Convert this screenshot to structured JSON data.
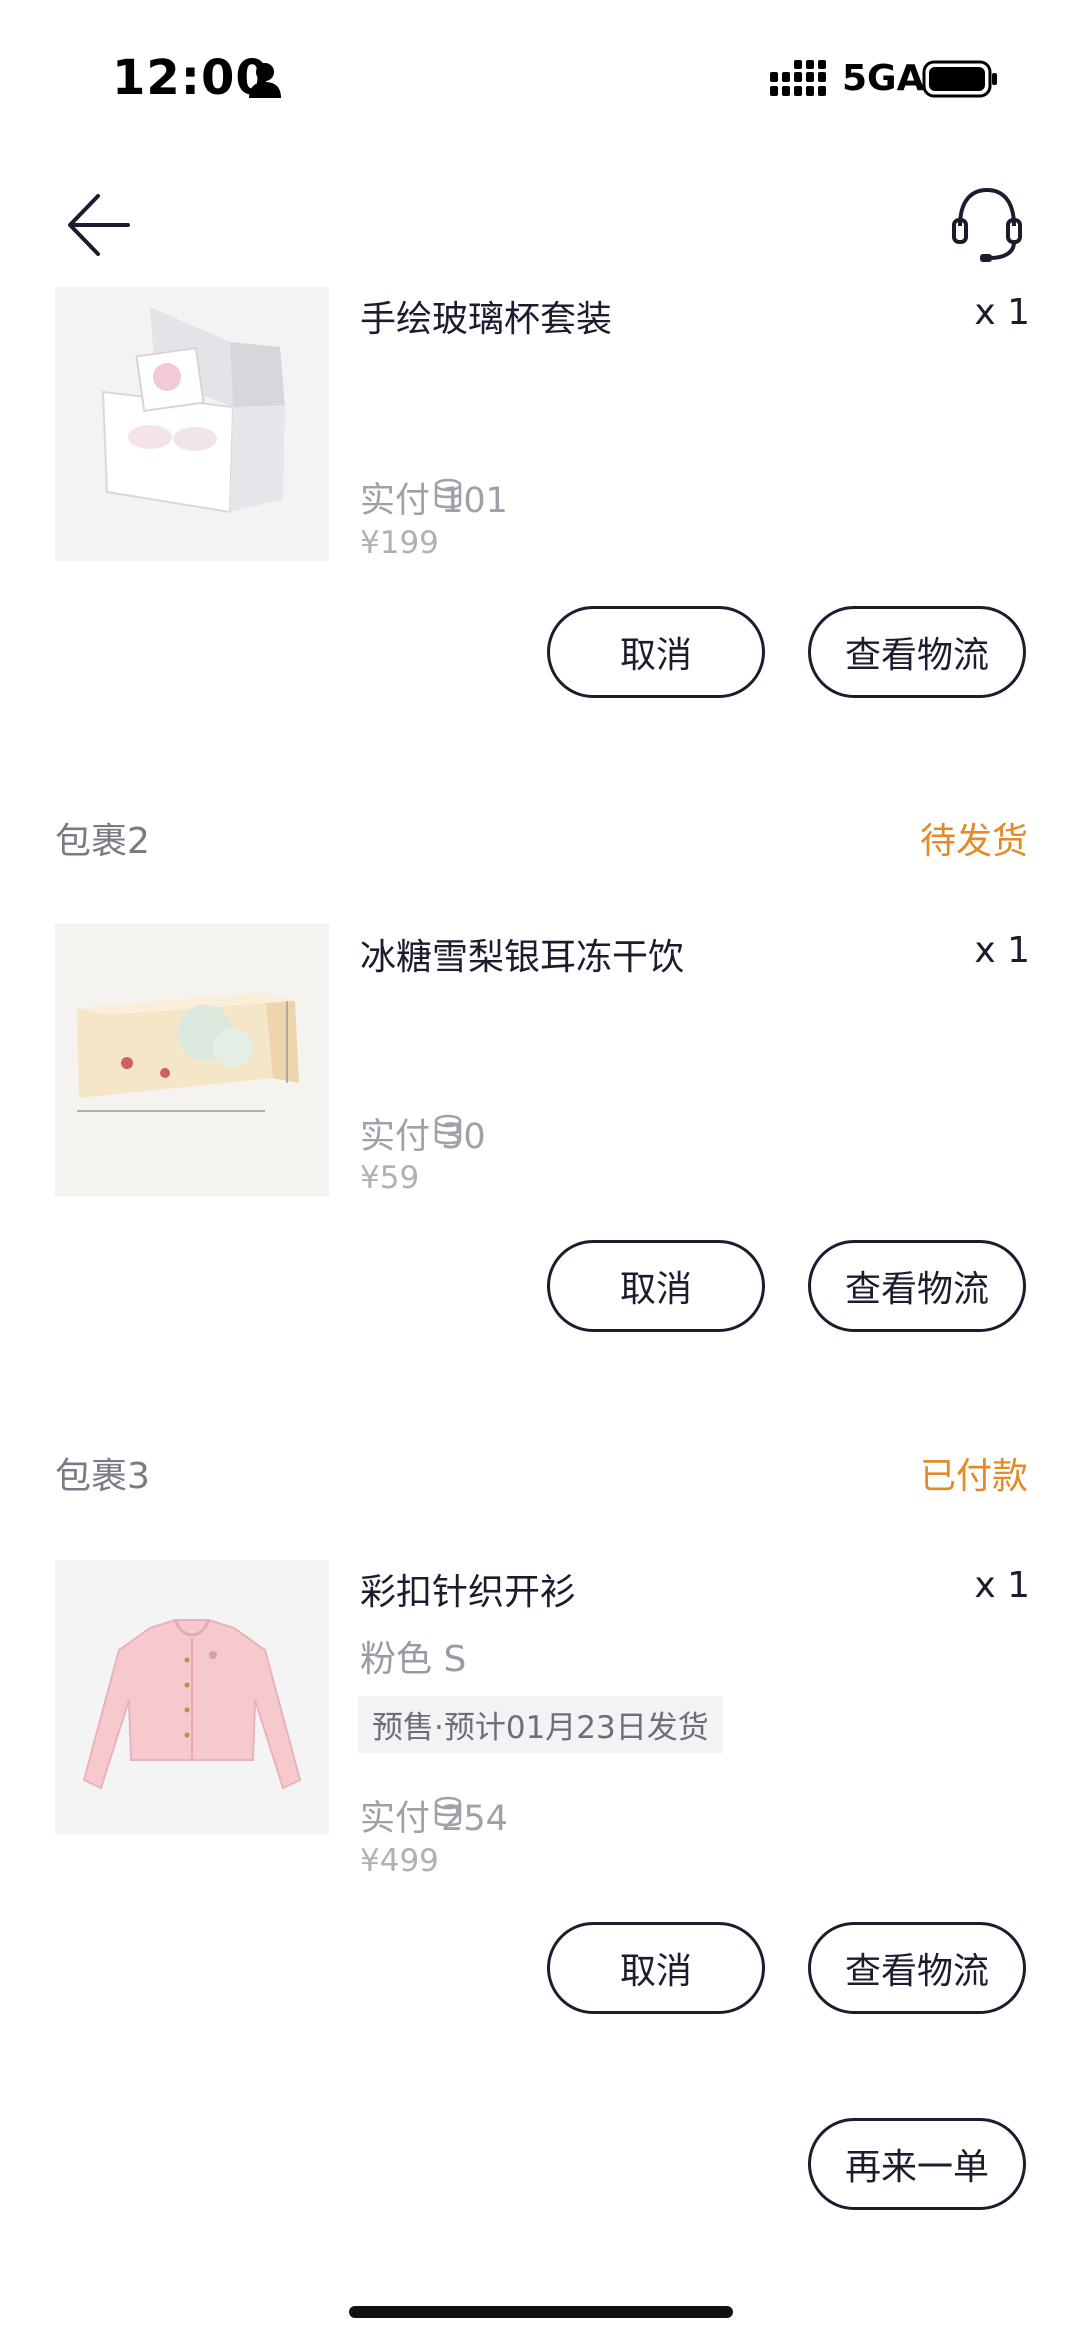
{
  "status_bar": {
    "time": "12:00",
    "network": "5GA"
  },
  "header": {
    "back_icon": "arrow-left-icon",
    "support_icon": "headset-icon"
  },
  "packages": [
    {
      "label": "",
      "status": "",
      "item": {
        "title": "手绘玻璃杯套装",
        "qty": "x 1",
        "paid": "实付 101",
        "price": "¥199",
        "image": "glass-cup-gift-box"
      },
      "buttons": {
        "cancel": "取消",
        "logistics": "查看物流"
      }
    },
    {
      "label": "包裹2",
      "status": "待发货",
      "item": {
        "title": "冰糖雪梨银耳冻干饮",
        "qty": "x 1",
        "paid": "实付 30",
        "price": "¥59",
        "image": "freeze-dried-drink-box"
      },
      "buttons": {
        "cancel": "取消",
        "logistics": "查看物流"
      }
    },
    {
      "label": "包裹3",
      "status": "已付款",
      "item": {
        "title": "彩扣针织开衫",
        "qty": "x 1",
        "variant": "粉色 S",
        "presale": "预售·预计01月23日发货",
        "paid": "实付 254",
        "price": "¥499",
        "image": "pink-knit-cardigan"
      },
      "buttons": {
        "cancel": "取消",
        "logistics": "查看物流"
      }
    }
  ],
  "reorder_button": "再来一单",
  "colors": {
    "accent_status": "#e58a25",
    "text_primary": "#1c1c2e",
    "text_muted": "#a0a0a8"
  }
}
